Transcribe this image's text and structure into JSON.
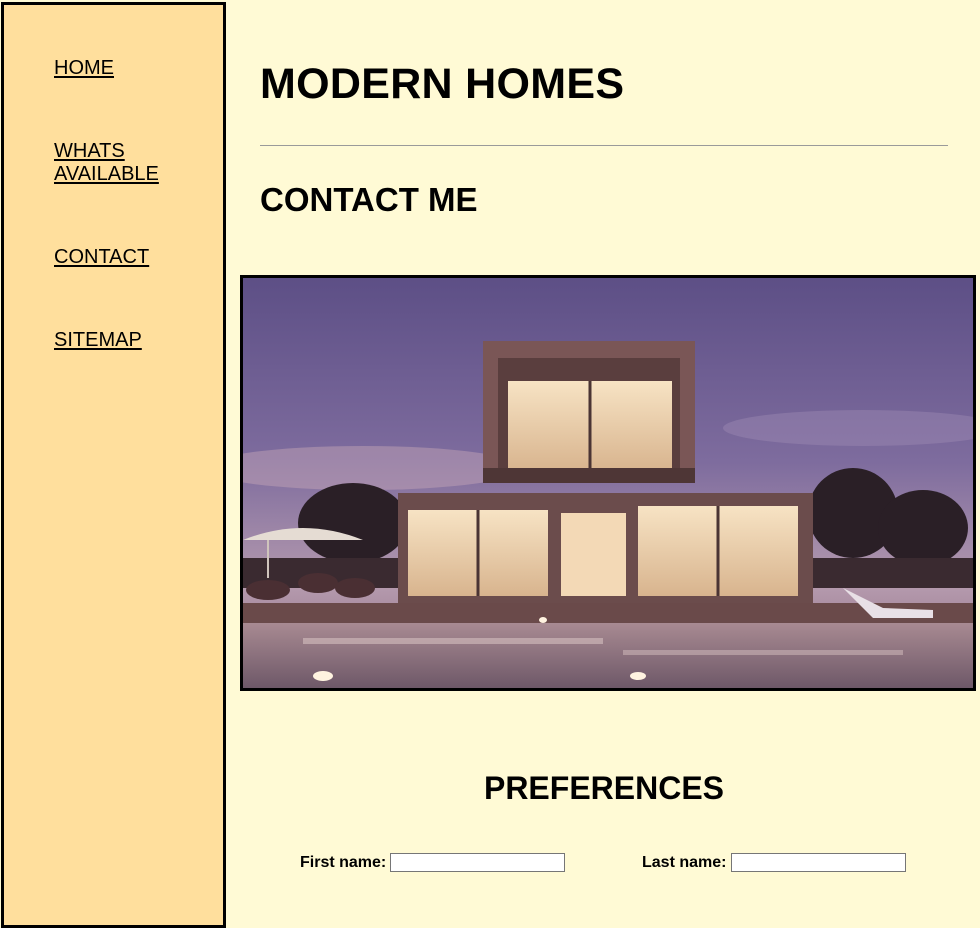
{
  "nav": {
    "items": [
      {
        "label": "HOME"
      },
      {
        "label": "WHATS AVAILABLE"
      },
      {
        "label": "CONTACT"
      },
      {
        "label": "SITEMAP"
      }
    ]
  },
  "header": {
    "title": "MODERN HOMES"
  },
  "main": {
    "section_title": "CONTACT ME",
    "hero_image": "modern-house-at-dusk-photo",
    "preferences": {
      "title": "PREFERENCES",
      "first_name_label": "First name:",
      "first_name_value": "",
      "last_name_label": "Last name:",
      "last_name_value": ""
    }
  },
  "colors": {
    "page_background": "#fffad5",
    "sidebar_background": "#ffdf9d",
    "border": "#000000"
  }
}
